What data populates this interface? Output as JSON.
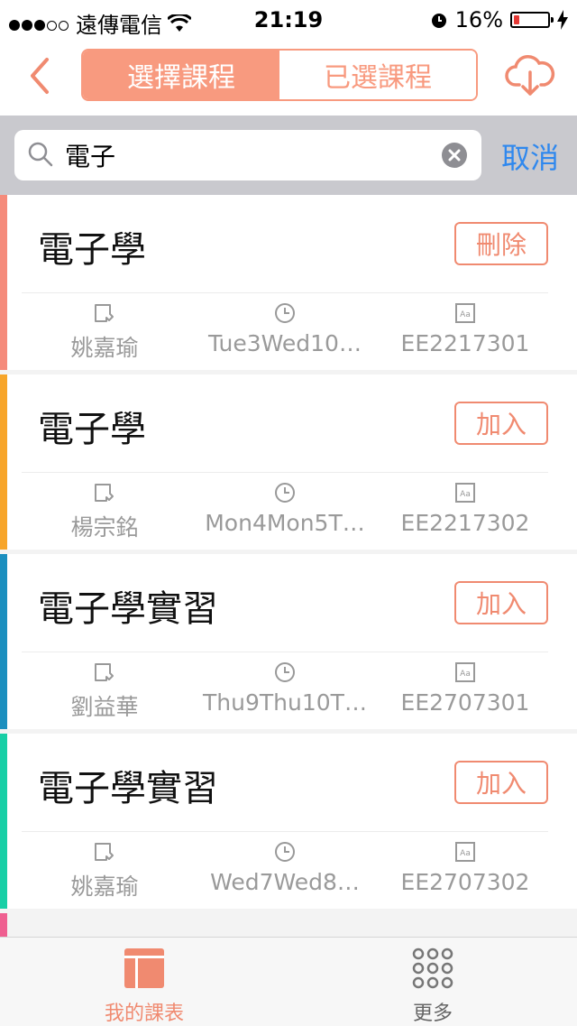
{
  "status": {
    "carrier": "遠傳電信",
    "time": "21:19",
    "battery": "16%",
    "battery_level": 0.16,
    "battery_color": "#e53935"
  },
  "header": {
    "back_icon": "back-chevron-icon",
    "tabs": [
      {
        "label": "選擇課程",
        "active": true
      },
      {
        "label": "已選課程",
        "active": false
      }
    ],
    "download_icon": "cloud-download-icon"
  },
  "search": {
    "value": "電子",
    "cancel_label": "取消"
  },
  "courses": [
    {
      "name": "電子學",
      "action": "刪除",
      "teacher": "姚嘉瑜",
      "time": "Tue3Wed10…",
      "code": "EE2217301",
      "color": "#f58b7b"
    },
    {
      "name": "電子學",
      "action": "加入",
      "teacher": "楊宗銘",
      "time": "Mon4Mon5T…",
      "code": "EE2217302",
      "color": "#f7a52a"
    },
    {
      "name": "電子學實習",
      "action": "加入",
      "teacher": "劉益華",
      "time": "Thu9Thu10T…",
      "code": "EE2707301",
      "color": "#1b8fbf"
    },
    {
      "name": "電子學實習",
      "action": "加入",
      "teacher": "姚嘉瑜",
      "time": "Wed7Wed8…",
      "code": "EE2707302",
      "color": "#18cfa6"
    }
  ],
  "next_color": "#ef5f90",
  "tabbar": {
    "tab1": "我的課表",
    "tab2": "更多"
  },
  "colors": {
    "accent": "#f89a7f",
    "link": "#2f88ee"
  }
}
